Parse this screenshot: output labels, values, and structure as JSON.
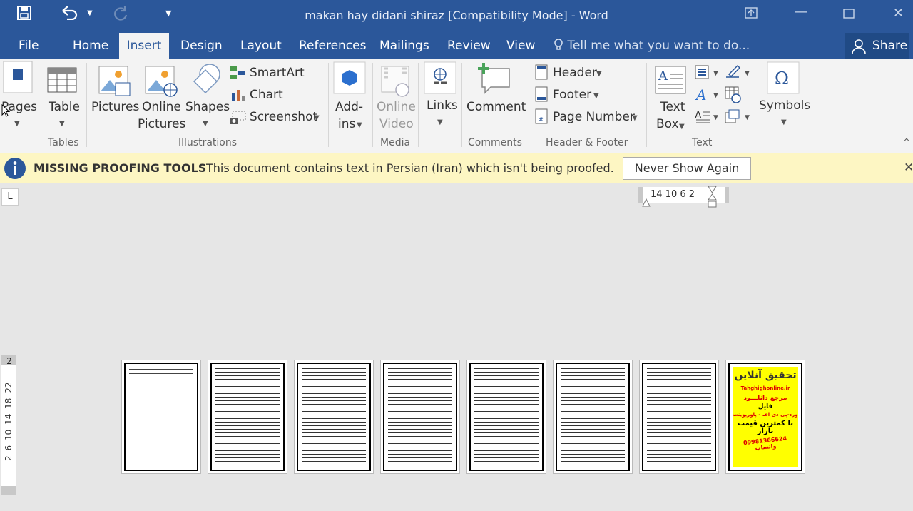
{
  "window": {
    "title": "makan hay didani shiraz [Compatibility Mode] - Word",
    "colors": {
      "accent": "#2b579a",
      "ribbon_bg": "#f3f3f3",
      "message_bar": "#fdf6c3"
    }
  },
  "qat": {
    "save_icon": "save-icon",
    "undo_icon": "undo-icon",
    "redo_icon": "redo-icon",
    "customize_icon": "customize-qat-icon"
  },
  "tabs": [
    {
      "label": "File"
    },
    {
      "label": "Home"
    },
    {
      "label": "Insert",
      "active": true
    },
    {
      "label": "Design"
    },
    {
      "label": "Layout"
    },
    {
      "label": "References"
    },
    {
      "label": "Mailings"
    },
    {
      "label": "Review"
    },
    {
      "label": "View"
    }
  ],
  "tell_me": "Tell me what you want to do...",
  "share": "Share",
  "ribbon": {
    "pages": "Pages",
    "table": "Table",
    "tables_group": "Tables",
    "pictures": "Pictures",
    "online_pictures_1": "Online",
    "online_pictures_2": "Pictures",
    "shapes": "Shapes",
    "smartart": "SmartArt",
    "chart": "Chart",
    "screenshot": "Screenshot",
    "illustrations_group": "Illustrations",
    "addins_1": "Add-",
    "addins_2": "ins",
    "online_video_1": "Online",
    "online_video_2": "Video",
    "media_group": "Media",
    "links": "Links",
    "comment": "Comment",
    "comments_group": "Comments",
    "header": "Header",
    "footer": "Footer",
    "page_number": "Page Number",
    "header_footer_group": "Header & Footer",
    "text_box_1": "Text",
    "text_box_2": "Box",
    "text_group": "Text",
    "symbols": "Symbols"
  },
  "message_bar": {
    "title": "MISSING PROOFING TOOLS",
    "text": "This document contains text in Persian (Iran) which isn't being proofed.",
    "button": "Never Show Again"
  },
  "ruler": {
    "horizontal": "14 10 6 2",
    "vertical": [
      "2",
      "2",
      "6",
      "10",
      "14",
      "18",
      "22"
    ]
  },
  "ad_page": {
    "line1": "تحقیق آنلاین",
    "line2": "Tahghighonline.ir",
    "line3": "مرجع دانلـــود",
    "line4": "فایل",
    "line5": "ورد-پی دی اف - پاورپوینت",
    "line6": "با کمترین قیمت بازار",
    "line7": "09981366624 واتساپ"
  }
}
